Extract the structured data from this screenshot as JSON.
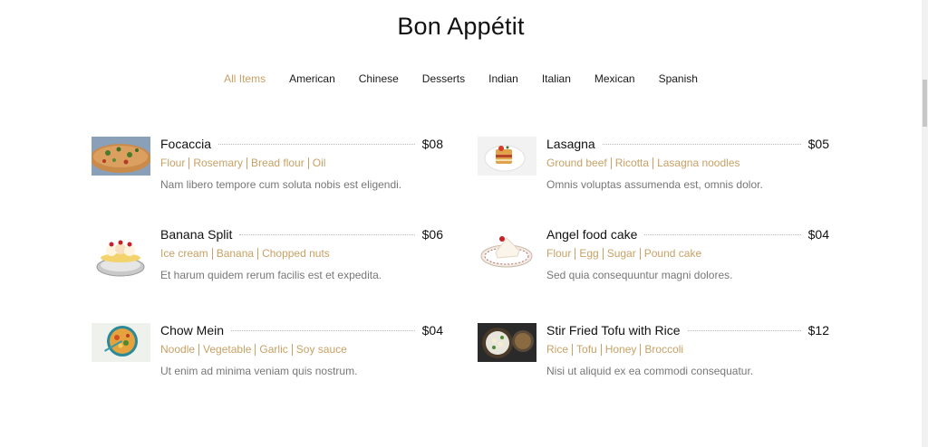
{
  "title": "Bon Appétit",
  "filters": [
    {
      "label": "All Items",
      "active": true
    },
    {
      "label": "American",
      "active": false
    },
    {
      "label": "Chinese",
      "active": false
    },
    {
      "label": "Desserts",
      "active": false
    },
    {
      "label": "Indian",
      "active": false
    },
    {
      "label": "Italian",
      "active": false
    },
    {
      "label": "Mexican",
      "active": false
    },
    {
      "label": "Spanish",
      "active": false
    }
  ],
  "colors": {
    "accent": "#c8a165",
    "text": "#111111",
    "muted": "#777777"
  },
  "items": [
    {
      "name": "Focaccia",
      "price": "$08",
      "ingredients": [
        "Flour",
        "Rosemary",
        "Bread flour",
        "Oil"
      ],
      "description": "Nam libero tempore cum soluta nobis est eligendi.",
      "image": "focaccia-image"
    },
    {
      "name": "Lasagna",
      "price": "$05",
      "ingredients": [
        "Ground beef",
        "Ricotta",
        "Lasagna noodles"
      ],
      "description": "Omnis voluptas assumenda est, omnis dolor.",
      "image": "lasagna-image"
    },
    {
      "name": "Banana Split",
      "price": "$06",
      "ingredients": [
        "Ice cream",
        "Banana",
        "Chopped nuts"
      ],
      "description": "Et harum quidem rerum facilis est et expedita.",
      "image": "banana-split-image"
    },
    {
      "name": "Angel food cake",
      "price": "$04",
      "ingredients": [
        "Flour",
        "Egg",
        "Sugar",
        "Pound cake"
      ],
      "description": "Sed quia consequuntur magni dolores.",
      "image": "angel-food-cake-image"
    },
    {
      "name": "Chow Mein",
      "price": "$04",
      "ingredients": [
        "Noodle",
        "Vegetable",
        "Garlic",
        "Soy sauce"
      ],
      "description": "Ut enim ad minima veniam quis nostrum.",
      "image": "chow-mein-image"
    },
    {
      "name": "Stir Fried Tofu with Rice",
      "price": "$12",
      "ingredients": [
        "Rice",
        "Tofu",
        "Honey",
        "Broccoli"
      ],
      "description": "Nisi ut aliquid ex ea commodi consequatur.",
      "image": "stir-fried-tofu-image"
    }
  ]
}
